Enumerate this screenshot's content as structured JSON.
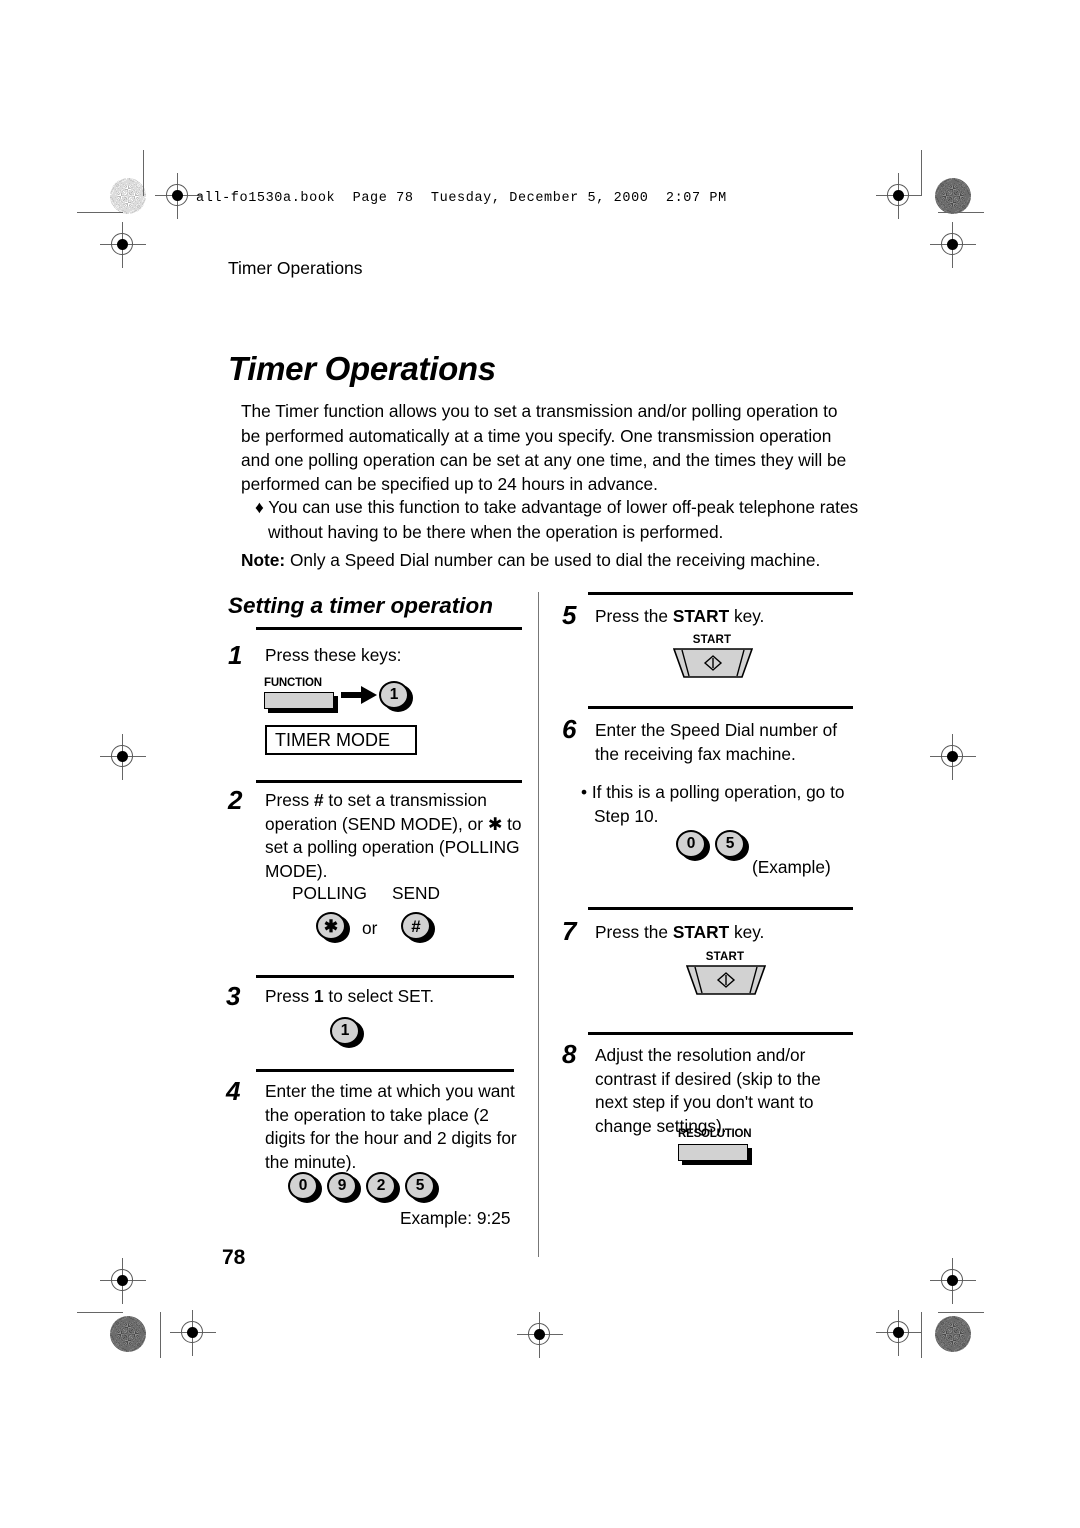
{
  "print_marks": {
    "file_header": "all-fo1530a.book  Page 78  Tuesday, December 5, 2000  2:07 PM"
  },
  "running_head": "Timer Operations",
  "page_title": "Timer Operations",
  "intro_paragraph": "The Timer function allows you to set a transmission and/or polling operation to be performed automatically at a time you specify. One transmission operation and one polling operation can be set at any one time, and the times they will be performed can be specified up to 24 hours in advance.",
  "bullet_paragraph": "♦ You can use this function to take advantage of lower off-peak telephone rates without having to be there when the operation is performed.",
  "note": {
    "label": "Note:",
    "text": " Only a Speed Dial number can be used to dial the receiving machine."
  },
  "subheading": "Setting a timer operation",
  "steps": {
    "step1": {
      "number": "1",
      "text": "Press these keys:",
      "function_key_label": "FUNCTION",
      "keypad_key": "1",
      "display_text": "TIMER MODE"
    },
    "step2": {
      "number": "2",
      "text_parts": {
        "a": "Press ",
        "hash": "#",
        "b": " to set a transmission operation (SEND MODE), or ",
        "star": "✱",
        "c": " to set a polling operation (POLLING MODE)."
      },
      "polling_label": "POLLING",
      "send_label": "SEND",
      "star_key": "✱",
      "or_label": "or",
      "hash_key": "#"
    },
    "step3": {
      "number": "3",
      "text_parts": {
        "a": "Press ",
        "b": "1",
        "c": " to select SET."
      },
      "keypad_key": "1"
    },
    "step4": {
      "number": "4",
      "text": "Enter the time at which you want the operation to take place (2 digits for the hour and 2 digits for the minute).",
      "keys": [
        "0",
        "9",
        "2",
        "5"
      ],
      "example": "Example: 9:25"
    },
    "step5": {
      "number": "5",
      "text_parts": {
        "a": "Press the ",
        "b": "START",
        "c": " key."
      },
      "start_key_label": "START"
    },
    "step6": {
      "number": "6",
      "text": "Enter the Speed Dial number of the receiving fax machine.",
      "bullet": "• If this is a polling operation, go to Step 10.",
      "keys": [
        "0",
        "5"
      ],
      "example": "(Example)"
    },
    "step7": {
      "number": "7",
      "text_parts": {
        "a": "Press the ",
        "b": "START",
        "c": " key."
      },
      "start_key_label": "START"
    },
    "step8": {
      "number": "8",
      "text": "Adjust the resolution and/or contrast if desired (skip to the next step if you don't want to change settings).",
      "resolution_key_label": "RESOLUTION"
    }
  },
  "page_number": "78",
  "colors": {
    "key_face": "#d2d2d2",
    "ink": "#000000",
    "paper": "#ffffff",
    "rule": "#000000",
    "divider": "#777777"
  }
}
